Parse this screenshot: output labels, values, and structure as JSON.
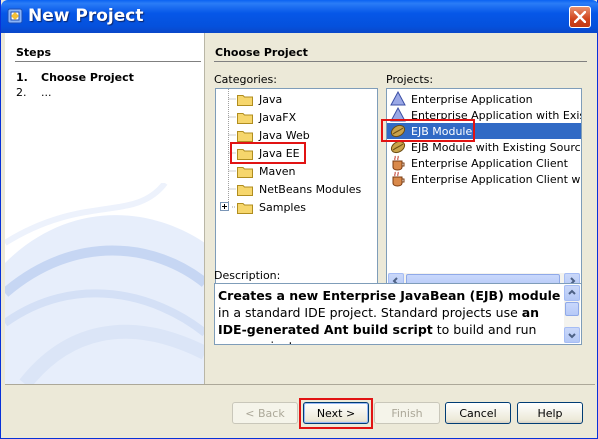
{
  "window": {
    "title": "New Project"
  },
  "steps": {
    "title": "Steps",
    "items": [
      {
        "num": "1.",
        "label": "Choose Project"
      },
      {
        "num": "2.",
        "label": "..."
      }
    ]
  },
  "main": {
    "section_title": "Choose Project",
    "categories_label": "Categories:",
    "projects_label": "Projects:",
    "description_label": "Description:",
    "categories": [
      {
        "label": "Java",
        "selected": false
      },
      {
        "label": "JavaFX",
        "selected": false
      },
      {
        "label": "Java Web",
        "selected": false
      },
      {
        "label": "Java EE",
        "selected": true
      },
      {
        "label": "Maven",
        "selected": false
      },
      {
        "label": "NetBeans Modules",
        "selected": false
      },
      {
        "label": "Samples",
        "selected": false,
        "expandable": true
      }
    ],
    "projects": [
      {
        "label": "Enterprise Application",
        "icon": "triangle-icon",
        "selected": false
      },
      {
        "label": "Enterprise Application with Existing",
        "icon": "triangle-icon",
        "selected": false
      },
      {
        "label": "EJB Module",
        "icon": "bean-icon",
        "selected": true
      },
      {
        "label": "EJB Module with Existing Sources",
        "icon": "bean-icon",
        "selected": false
      },
      {
        "label": "Enterprise Application Client",
        "icon": "coffee-icon",
        "selected": false
      },
      {
        "label": "Enterprise Application Client with Ex",
        "icon": "coffee-icon",
        "selected": false
      }
    ],
    "description": {
      "p1_bold": "Creates a new Enterprise JavaBean (EJB) module",
      "p1_rest": " in a standard IDE project. Standard projects use ",
      "p2_bold": "an IDE-generated Ant build script",
      "p2_rest": " to build and run your project."
    }
  },
  "buttons": {
    "back": "< Back",
    "next": "Next >",
    "finish": "Finish",
    "cancel": "Cancel",
    "help": "Help"
  },
  "colors": {
    "selection": "#316ac5",
    "highlight": "#e11313",
    "titlebar": "#0657e8"
  }
}
